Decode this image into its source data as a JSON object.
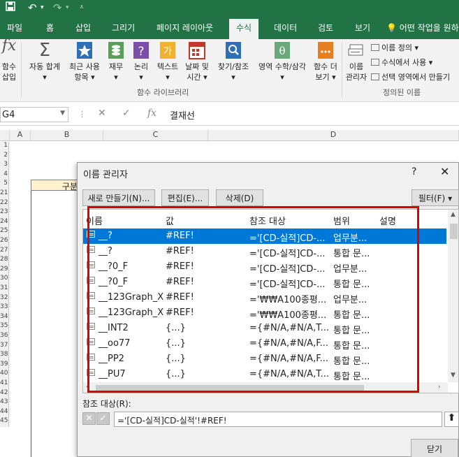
{
  "quick_access": {
    "save_icon": "save-icon",
    "undo_icon": "undo-icon",
    "redo_icon": "redo-icon",
    "customize_icon": "customize-icon"
  },
  "tabs": [
    {
      "label": "파일"
    },
    {
      "label": "홈"
    },
    {
      "label": "삽입"
    },
    {
      "label": "그리기"
    },
    {
      "label": "페이지 레이아웃"
    },
    {
      "label": "수식"
    },
    {
      "label": "데이터"
    },
    {
      "label": "검토"
    },
    {
      "label": "보기"
    }
  ],
  "active_tab": "수식",
  "tell_me": "어떤 작업을 원하",
  "ribbon": {
    "insert_function": {
      "line1": "함수",
      "line2": "삽입"
    },
    "autosum": {
      "line1": "자동 합계"
    },
    "recent": {
      "line1": "최근 사용",
      "line2": "항목"
    },
    "financial": {
      "line1": "재무"
    },
    "logical": {
      "line1": "논리"
    },
    "text": {
      "line1": "텍스트"
    },
    "datetime": {
      "line1": "날짜 및",
      "line2": "시간"
    },
    "lookup": {
      "line1": "찾기/참조"
    },
    "mathtrig": {
      "line1": "영역 수학/삼각"
    },
    "more": {
      "line1": "함수 더",
      "line2": "보기"
    },
    "name_manager": {
      "line1": "이름",
      "line2": "관리자"
    },
    "define_name": "이름 정의",
    "use_in_formula": "수식에서 사용",
    "create_from_selection": "선택 영역에서 만들기",
    "group_library": "함수 라이브러리",
    "group_defined_names": "정의된 이름"
  },
  "formula_bar": {
    "name_box": "G4",
    "fx": "fx",
    "content": "결재선"
  },
  "columns": [
    "A",
    "B",
    "C",
    "D"
  ],
  "rows": [
    "1",
    "2",
    "3",
    "4",
    "5",
    "21",
    "22",
    "23",
    "24",
    "25",
    "26",
    "27",
    "28",
    "29",
    "30",
    "31",
    "32",
    "33",
    "34",
    "35",
    "36",
    "37",
    "38",
    "39",
    "40",
    "41",
    "42",
    "43",
    "44",
    "45"
  ],
  "cell_b5": "구분",
  "dialog": {
    "title": "이름 관리자",
    "help": "?",
    "close": "✕",
    "new_button": "새로 만들기(N)...",
    "edit_button": "편집(E)...",
    "delete_button": "삭제(D)",
    "filter_button": "필터(F)",
    "headers": {
      "name": "이름",
      "value": "값",
      "refers_to": "참조 대상",
      "scope": "범위",
      "comment": "설명"
    },
    "rows": [
      {
        "name": "__?",
        "value": "#REF!",
        "refers_to": "='[CD-실적]CD-...",
        "scope": "업무분...",
        "selected": true
      },
      {
        "name": "__?",
        "value": "#REF!",
        "refers_to": "='[CD-실적]CD-...",
        "scope": "통합 문..."
      },
      {
        "name": "__?0_F",
        "value": "#REF!",
        "refers_to": "='[CD-실적]CD-...",
        "scope": "업무분..."
      },
      {
        "name": "__?0_F",
        "value": "#REF!",
        "refers_to": "='[CD-실적]CD-...",
        "scope": "통합 문..."
      },
      {
        "name": "__123Graph_X",
        "value": "#REF!",
        "refers_to": "='₩₩A100종평...",
        "scope": "업무분..."
      },
      {
        "name": "__123Graph_X",
        "value": "#REF!",
        "refers_to": "='₩₩A100종평...",
        "scope": "통합 문..."
      },
      {
        "name": "__INT2",
        "value": "{...}",
        "refers_to": "={#N/A,#N/A,T...",
        "scope": "통합 문..."
      },
      {
        "name": "__oo77",
        "value": "{...}",
        "refers_to": "={#N/A,#N/A,F...",
        "scope": "통합 문..."
      },
      {
        "name": "__PP2",
        "value": "{...}",
        "refers_to": "={#N/A,#N/A,F...",
        "scope": "통합 문..."
      },
      {
        "name": "__PU7",
        "value": "{...}",
        "refers_to": "={#N/A,#N/A,T...",
        "scope": "통합 문..."
      }
    ],
    "refers_to_label": "참조 대상(R):",
    "refers_to_value": "='[CD-실적]CD-실적'!#REF!",
    "close_button": "닫기"
  },
  "colors": {
    "excel_green": "#217346",
    "selection_blue": "#0078d7",
    "highlight_red": "#e00000"
  }
}
